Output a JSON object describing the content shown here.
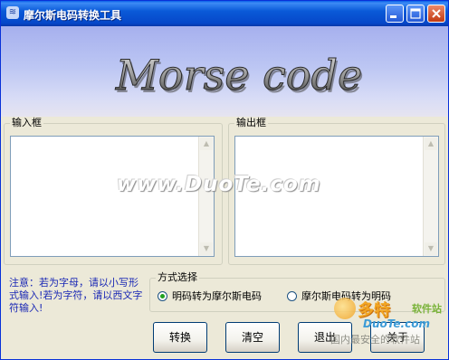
{
  "window": {
    "title": "摩尔斯电码转换工具",
    "icon": "app-icon",
    "controls": {
      "minimize": "_",
      "maximize": "□",
      "close": "✕"
    }
  },
  "banner": {
    "logo_text": "Morse code"
  },
  "input_panel": {
    "label": "输入框",
    "value": ""
  },
  "output_panel": {
    "label": "输出框",
    "value": ""
  },
  "watermark": "www.DuoTe.com",
  "note": "注意：若为字母，请以小写形式输入!若为字符，请以西文字符输入!",
  "mode_group": {
    "label": "方式选择",
    "options": [
      {
        "label": "明码转为摩尔斯电码",
        "selected": true
      },
      {
        "label": "摩尔斯电码转为明码",
        "selected": false
      }
    ]
  },
  "buttons": {
    "convert": "转换",
    "clear": "清空",
    "exit": "退出",
    "about": "关于"
  },
  "branding": {
    "name": "多特",
    "tag": "软件站",
    "site": "DuoTe.com",
    "slogan": "国内最安全的软件站"
  },
  "colors": {
    "title_bar": "#0a5ad8",
    "note_text": "#1a28b5",
    "radio_dot": "#21a121"
  }
}
